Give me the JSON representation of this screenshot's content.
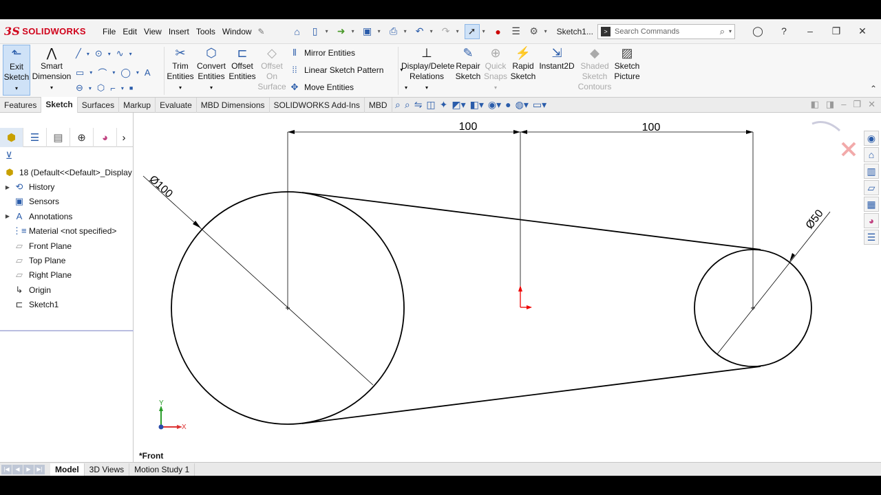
{
  "app": {
    "brand": "SOLIDWORKS",
    "brand_prefix": "3S",
    "doc_title": "Sketch1..."
  },
  "menu": [
    "File",
    "Edit",
    "View",
    "Insert",
    "Tools",
    "Window"
  ],
  "search": {
    "placeholder": "Search Commands"
  },
  "commands": {
    "exit_sketch": "Exit Sketch",
    "smart_dimension": "Smart Dimension",
    "trim": "Trim Entities",
    "convert": "Convert Entities",
    "offset": "Offset Entities",
    "offset_surface": "Offset On Surface",
    "mirror": "Mirror Entities",
    "linear_pattern": "Linear Sketch Pattern",
    "move": "Move Entities",
    "relations": "Display/Delete Relations",
    "repair": "Repair Sketch",
    "quick_snaps": "Quick Snaps",
    "rapid": "Rapid Sketch",
    "instant2d": "Instant2D",
    "shaded": "Shaded Sketch Contours",
    "picture": "Sketch Picture"
  },
  "tabs": [
    "Features",
    "Sketch",
    "Surfaces",
    "Markup",
    "Evaluate",
    "MBD Dimensions",
    "SOLIDWORKS Add-Ins",
    "MBD"
  ],
  "active_tab": "Sketch",
  "tree": {
    "root": "18 (Default<<Default>_Display",
    "items": [
      {
        "label": "History",
        "expand": true
      },
      {
        "label": "Sensors",
        "expand": false
      },
      {
        "label": "Annotations",
        "expand": true
      },
      {
        "label": "Material <not specified>",
        "expand": false
      },
      {
        "label": "Front Plane",
        "expand": false
      },
      {
        "label": "Top Plane",
        "expand": false
      },
      {
        "label": "Right Plane",
        "expand": false
      },
      {
        "label": "Origin",
        "expand": false
      },
      {
        "label": "Sketch1",
        "expand": false
      }
    ]
  },
  "sketch": {
    "dim_left": "100",
    "dim_right": "100",
    "dia_large": "Ø100",
    "dia_small": "Ø50",
    "view_label": "*Front",
    "axis_x": "X",
    "axis_y": "Y"
  },
  "bottom_tabs": [
    "Model",
    "3D Views",
    "Motion Study 1"
  ],
  "active_bottom_tab": "Model"
}
